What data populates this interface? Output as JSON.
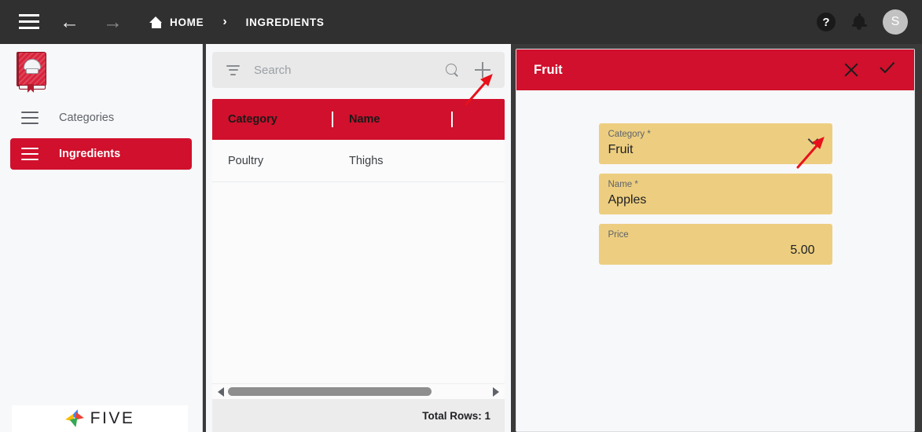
{
  "topbar": {
    "menu_icon": "hamburger-menu-icon",
    "back_icon": "arrow-left-icon",
    "forward_icon": "arrow-right-icon",
    "back_glyph": "←",
    "forward_glyph": "→",
    "home_label": "HOME",
    "separator": "›",
    "current_label": "INGREDIENTS",
    "help_glyph": "?",
    "avatar_initial": "S"
  },
  "sidebar": {
    "logo_name": "recipe-book-logo",
    "items": [
      {
        "label": "Categories",
        "active": false
      },
      {
        "label": "Ingredients",
        "active": true
      }
    ],
    "footer_logo_text": "FIVE"
  },
  "list": {
    "search": {
      "placeholder": "Search",
      "value": ""
    },
    "add_icon": "plus-icon",
    "filter_icon": "filter-icon",
    "search_icon": "search-icon",
    "columns": [
      "Category",
      "Name"
    ],
    "rows": [
      {
        "category": "Poultry",
        "name": "Thighs"
      }
    ],
    "footer_total": "Total Rows: 1"
  },
  "form": {
    "title": "Fruit",
    "close_icon": "close-icon",
    "save_icon": "check-icon",
    "fields": [
      {
        "label": "Category *",
        "value": "Fruit",
        "type": "select",
        "align": "left"
      },
      {
        "label": "Name *",
        "value": "Apples",
        "type": "text",
        "align": "left"
      },
      {
        "label": "Price",
        "value": "5.00",
        "type": "number",
        "align": "right"
      }
    ]
  },
  "annotations": [
    {
      "name": "arrow-to-add-button",
      "color": "#e8111b"
    },
    {
      "name": "arrow-to-category-dropdown",
      "color": "#e8111b"
    }
  ],
  "colors": {
    "brand_red": "#d0102c",
    "topbar_dark": "#303030",
    "field_tan": "#edce80",
    "panel_bg": "#f7f8fa"
  }
}
